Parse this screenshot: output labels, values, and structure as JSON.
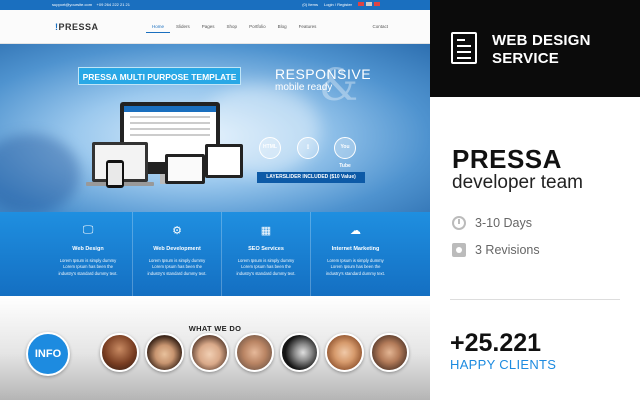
{
  "preview": {
    "topbar": {
      "email": "support@yoursite.com",
      "phone": "+09 264 222 21 21",
      "items": "(0) Items",
      "login": "Login / Register"
    },
    "nav": {
      "logo_mark": "!",
      "logo": "PRESSA",
      "menu": [
        "Home",
        "Sliders",
        "Pages",
        "Shop",
        "Portfolio",
        "Blog",
        "Features"
      ],
      "contact": "Contact"
    },
    "hero": {
      "badge": "PRESSA MULTI PURPOSE TEMPLATE",
      "responsive": "RESPONSIVE",
      "mobile": "mobile ready",
      "ampersand": "&",
      "circles": [
        "HTML",
        "",
        "You Tube"
      ],
      "layerslider": "LAYERSLIDER INCLUDED ($10 Value)"
    },
    "services": [
      {
        "icon": "monitor-icon",
        "glyph": "🖵",
        "title": "Web Design",
        "desc": "Lorem Ipsum is simply dummy Lorem Ipsum has been the industry's standard dummy text."
      },
      {
        "icon": "gear-icon",
        "glyph": "⚙",
        "title": "Web Development",
        "desc": "Lorem Ipsum is simply dummy Lorem Ipsum has been the industry's standard dummy text."
      },
      {
        "icon": "grid-icon",
        "glyph": "▦",
        "title": "SEO Services",
        "desc": "Lorem Ipsum is simply dummy Lorem Ipsum has been the industry's standard dummy text."
      },
      {
        "icon": "cloud-icon",
        "glyph": "☁",
        "title": "Internet Marketing",
        "desc": "Lorem Ipsum is simply dummy Lorem Ipsum has been the industry's standard dummy text."
      }
    ],
    "team": {
      "heading": "WHAT WE DO",
      "info_label": "INFO"
    }
  },
  "panel": {
    "header": "WEB DESIGN SERVICE",
    "header_line1": "WEB DESIGN",
    "header_line2": "SERVICE",
    "project_name": "PRESSA",
    "subtitle": "developer team",
    "delivery": "3-10 Days",
    "revisions": "3 Revisions",
    "client_count": "+25.221",
    "client_label": "HAPPY CLIENTS"
  },
  "colors": {
    "accent": "#1d8be0",
    "header_bg": "#0b0b0b",
    "services_bg": "#1a7fd3"
  }
}
